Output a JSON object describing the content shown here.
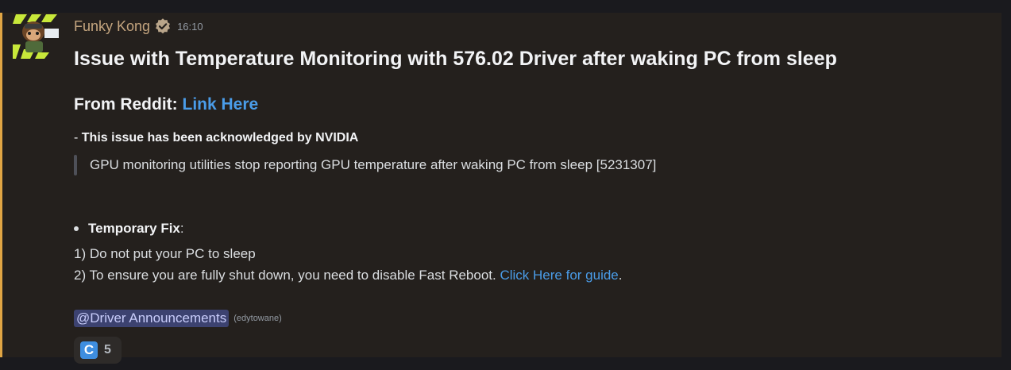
{
  "message": {
    "author": "Funky Kong",
    "timestamp": "16:10",
    "title": "Issue with Temperature Monitoring with 576.02 Driver after waking PC from sleep",
    "source_label": "From Reddit: ",
    "source_link": "Link Here",
    "ack_prefix": "- ",
    "ack_text": "This issue has been acknowledged by NVIDIA",
    "quote": "GPU monitoring utilities stop reporting GPU temperature after waking PC from sleep [5231307]",
    "fix_label": "Temporary Fix",
    "fix_colon": ":",
    "step1": "1) Do not put your PC to sleep",
    "step2_text": "2) To ensure you are fully shut down, you need to disable Fast Reboot. ",
    "step2_link": "Click Here for guide",
    "step2_end": ".",
    "mention": "@Driver Announcements",
    "mention_sub": "(edytowane)"
  },
  "reaction": {
    "emoji_letter": "C",
    "count": "5"
  },
  "colors": {
    "accent_bar": "#e0a544",
    "link": "#4a9ce8",
    "username": "#c3a47e",
    "mention_bg": "#3c4270"
  },
  "icons": [
    "avatar",
    "verified-icon",
    "reaction-emoji-icon"
  ]
}
